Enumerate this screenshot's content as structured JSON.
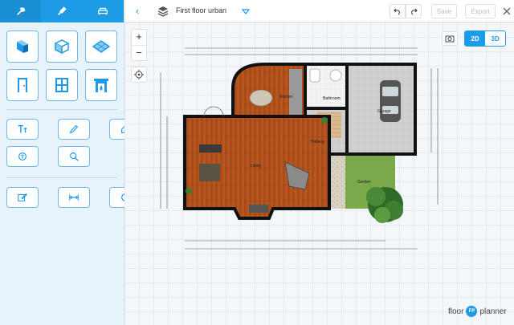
{
  "sidebar": {
    "tabs": [
      {
        "icon": "hammer-icon",
        "active": true
      },
      {
        "icon": "paint-brush-icon",
        "active": false
      },
      {
        "icon": "armchair-icon",
        "active": false
      }
    ],
    "build_tools": [
      "wall-panel-icon",
      "room-box-icon",
      "floor-tile-icon",
      "door-icon",
      "window-icon",
      "fireplace-icon"
    ],
    "annotate_tools": [
      "text-tool-icon",
      "pencil-icon",
      "house-label-icon",
      "symbol-icon",
      "dimension-search-icon"
    ],
    "edit_tools": [
      "edit-icon",
      "measure-icon",
      "refresh-icon"
    ]
  },
  "topbar": {
    "floor_name": "First floor urban",
    "save_label": "Save",
    "export_label": "Export"
  },
  "view": {
    "mode_2d": "2D",
    "mode_3d": "3D",
    "active": "2D"
  },
  "plan": {
    "rooms": {
      "kitchen": "Kitchen",
      "bathroom": "Bathroom",
      "garage": "Garage",
      "hallway": "Hallway",
      "living": "Living",
      "garden": "Garden"
    }
  },
  "brand": {
    "left": "floor",
    "right": "planner",
    "logo_text": "FP"
  },
  "colors": {
    "accent": "#1e9be6",
    "wall": "#111111",
    "wood": "#b5551f",
    "tile": "#c9c9c9",
    "grass": "#7fae4a"
  }
}
